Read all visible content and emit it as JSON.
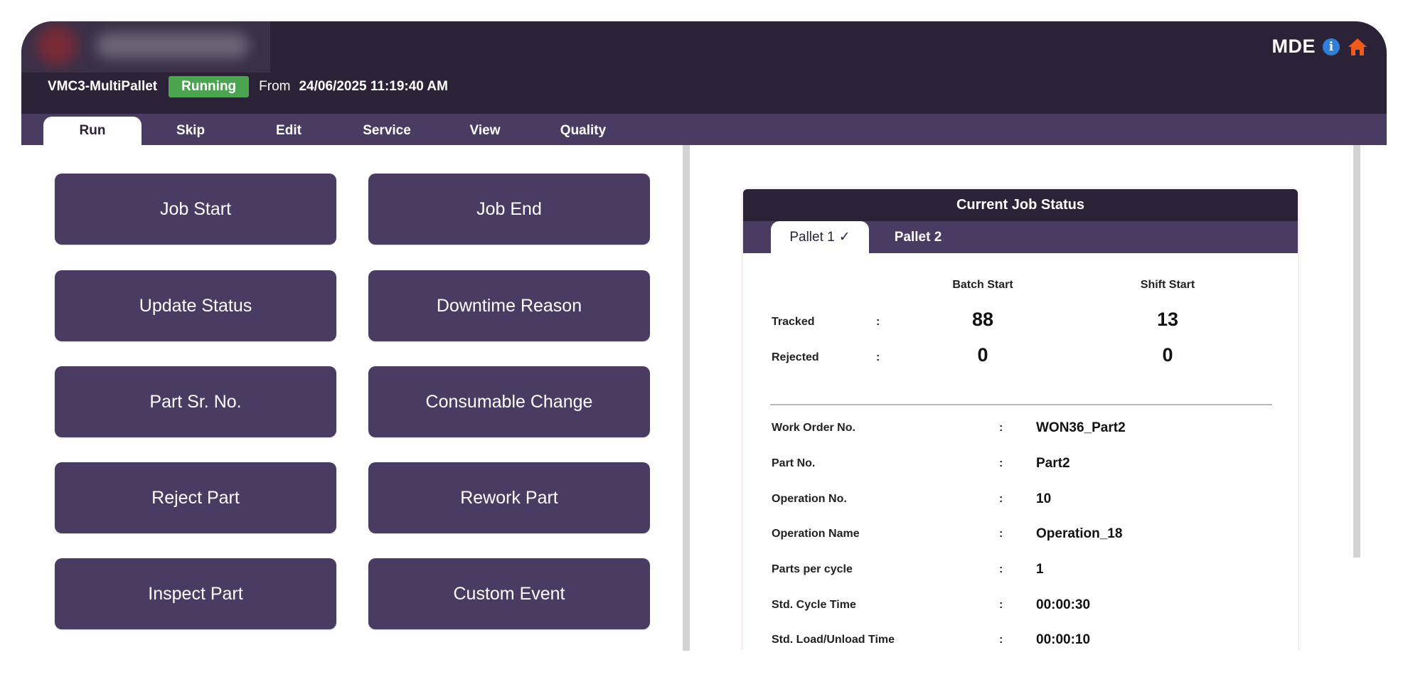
{
  "header": {
    "brand": "MDE",
    "machine_name": "VMC3-MultiPallet",
    "status": "Running",
    "from_label": "From",
    "from_datetime": "24/06/2025 11:19:40 AM",
    "icons": [
      "info-icon",
      "home-icon"
    ],
    "colors": {
      "header_bg": "#2b2238",
      "accent": "#4a3b62",
      "running": "#4aa450",
      "home": "#f25a1c",
      "info": "#2f7ed8"
    }
  },
  "tabs": [
    {
      "label": "Run",
      "active": true
    },
    {
      "label": "Skip"
    },
    {
      "label": "Edit"
    },
    {
      "label": "Service"
    },
    {
      "label": "View"
    },
    {
      "label": "Quality"
    }
  ],
  "actions": [
    "Job Start",
    "Job End",
    "Update Status",
    "Downtime Reason",
    "Part Sr. No.",
    "Consumable Change",
    "Reject Part",
    "Rework Part",
    "Inspect Part",
    "Custom Event"
  ],
  "job_status": {
    "title": "Current Job Status",
    "pallets": [
      {
        "label": "Pallet 1",
        "check": "✓",
        "active": true
      },
      {
        "label": "Pallet 2"
      }
    ],
    "columns": [
      "Batch Start",
      "Shift Start"
    ],
    "colon": ":",
    "rows": [
      {
        "label": "Tracked",
        "batch": "88",
        "shift": "13"
      },
      {
        "label": "Rejected",
        "batch": "0",
        "shift": "0"
      }
    ],
    "details": [
      {
        "label": "Work Order No.",
        "value": "WON36_Part2"
      },
      {
        "label": "Part No.",
        "value": "Part2"
      },
      {
        "label": "Operation No.",
        "value": "10"
      },
      {
        "label": "Operation Name",
        "value": "Operation_18"
      },
      {
        "label": "Parts per cycle",
        "value": "1"
      },
      {
        "label": "Std. Cycle Time",
        "value": "00:00:30"
      },
      {
        "label": "Std. Load/Unload Time",
        "value": "00:00:10"
      }
    ]
  }
}
